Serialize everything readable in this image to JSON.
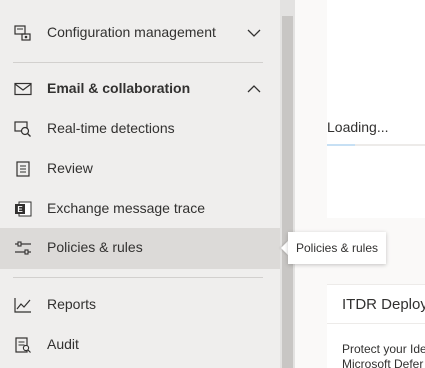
{
  "sidebar": {
    "items": [
      {
        "label": "Configuration management",
        "icon": "configuration-icon",
        "chevron": "chevron-down-icon"
      },
      {
        "label": "Email & collaboration",
        "icon": "email-icon",
        "chevron": "chevron-up-icon"
      },
      {
        "label": "Real-time detections",
        "icon": "detections-icon"
      },
      {
        "label": "Review",
        "icon": "review-icon"
      },
      {
        "label": "Exchange message trace",
        "icon": "exchange-icon"
      },
      {
        "label": "Policies & rules",
        "icon": "policies-icon",
        "selected": true
      },
      {
        "label": "Reports",
        "icon": "reports-icon"
      },
      {
        "label": "Audit",
        "icon": "audit-icon"
      }
    ]
  },
  "tooltip": {
    "text": "Policies & rules"
  },
  "main": {
    "loading_text": "Loading...",
    "card": {
      "title": "ITDR Deploym",
      "body_line1": "Protect your Ide",
      "body_line2": "Microsoft Defer"
    }
  },
  "colors": {
    "sidebar_bg": "#efeeed",
    "selected_bg": "#dcdad8",
    "text": "#323130",
    "loading_accent": "#c7e0f4"
  }
}
